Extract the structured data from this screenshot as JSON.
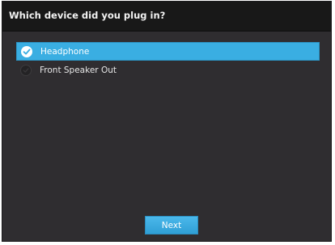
{
  "dialog": {
    "title": "Which device did you plug in?"
  },
  "options": [
    {
      "label": "Headphone",
      "selected": true,
      "icon": "check-icon"
    },
    {
      "label": "Front Speaker Out",
      "selected": false,
      "icon": "radio-empty-icon"
    }
  ],
  "buttons": {
    "next_label": "Next"
  },
  "colors": {
    "background": "#2f2d30",
    "title_bar": "#181818",
    "accent": "#3aaee2",
    "text": "#ffffff"
  }
}
